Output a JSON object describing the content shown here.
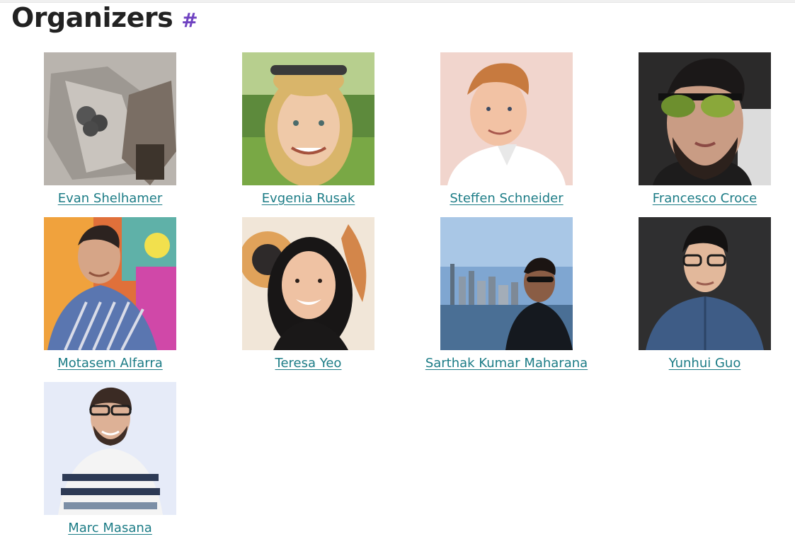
{
  "section": {
    "title": "Organizers",
    "anchor": "#"
  },
  "organizers": [
    {
      "name": "Evan Shelhamer"
    },
    {
      "name": "Evgenia Rusak"
    },
    {
      "name": "Steffen Schneider"
    },
    {
      "name": "Francesco Croce"
    },
    {
      "name": "Motasem Alfarra"
    },
    {
      "name": "Teresa Yeo"
    },
    {
      "name": "Sarthak Kumar Maharana"
    },
    {
      "name": "Yunhui Guo"
    },
    {
      "name": "Marc Masana"
    }
  ],
  "colors": {
    "link": "#1c7c86",
    "anchor": "#6f42c1",
    "heading": "#222222"
  }
}
